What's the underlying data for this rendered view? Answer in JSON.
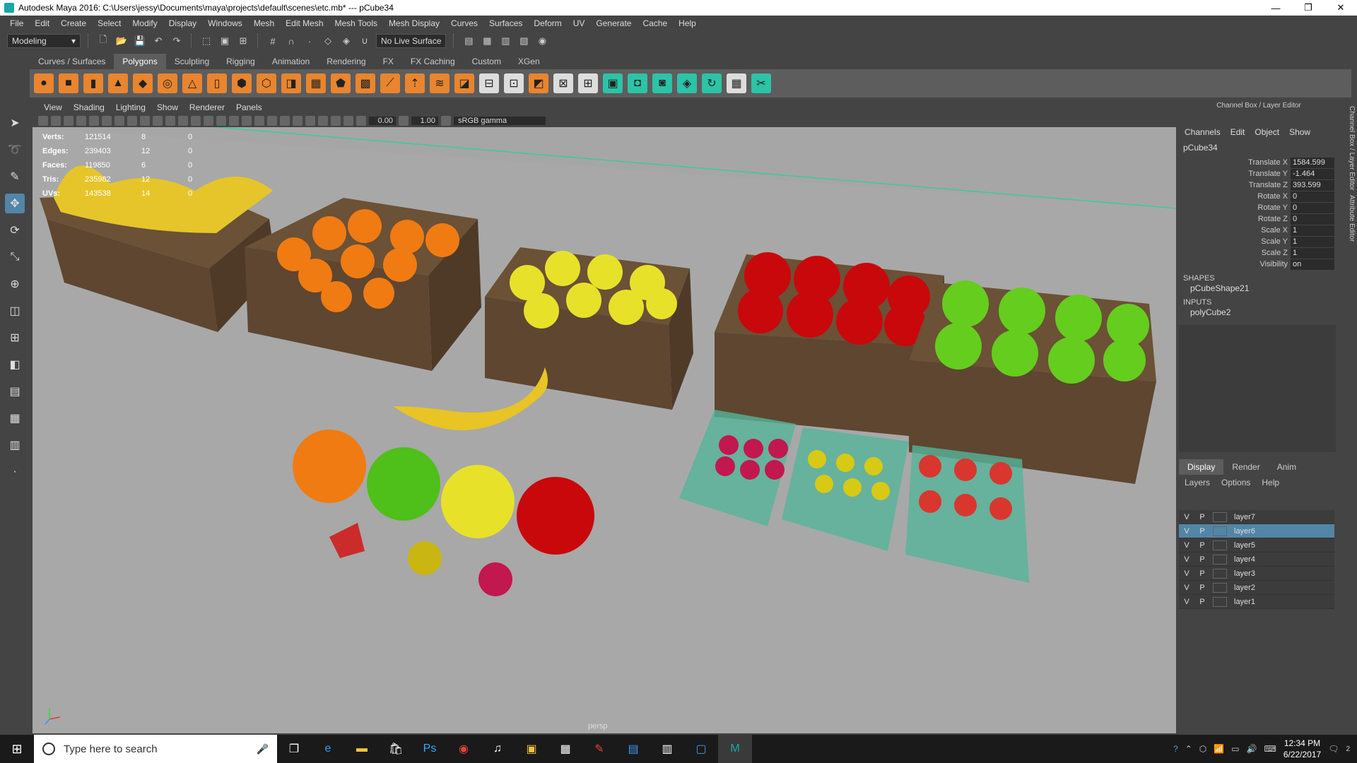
{
  "titlebar": {
    "title": "Autodesk Maya 2016: C:\\Users\\jessy\\Documents\\maya\\projects\\default\\scenes\\etc.mb*  ---  pCube34"
  },
  "menubar": [
    "File",
    "Edit",
    "Create",
    "Select",
    "Modify",
    "Display",
    "Windows",
    "Mesh",
    "Edit Mesh",
    "Mesh Tools",
    "Mesh Display",
    "Curves",
    "Surfaces",
    "Deform",
    "UV",
    "Generate",
    "Cache",
    "Help"
  ],
  "statusline": {
    "mode": "Modeling",
    "live_surface": "No Live Surface"
  },
  "shelf_tabs": [
    "Curves / Surfaces",
    "Polygons",
    "Sculpting",
    "Rigging",
    "Animation",
    "Rendering",
    "FX",
    "FX Caching",
    "Custom",
    "XGen"
  ],
  "shelf_active": "Polygons",
  "viewport": {
    "menu": [
      "View",
      "Shading",
      "Lighting",
      "Show",
      "Renderer",
      "Panels"
    ],
    "exposure": "0.00",
    "gamma_value": "1.00",
    "color_space": "sRGB gamma",
    "camera": "persp",
    "hud": [
      {
        "k": "Verts:",
        "v": "121514",
        "a": "8",
        "b": "0"
      },
      {
        "k": "Edges:",
        "v": "239403",
        "a": "12",
        "b": "0"
      },
      {
        "k": "Faces:",
        "v": "119850",
        "a": "6",
        "b": "0"
      },
      {
        "k": "Tris:",
        "v": "235982",
        "a": "12",
        "b": "0"
      },
      {
        "k": "UVs:",
        "v": "143538",
        "a": "14",
        "b": "0"
      }
    ]
  },
  "channel_box": {
    "title": "Channel Box / Layer Editor",
    "menu": [
      "Channels",
      "Edit",
      "Object",
      "Show"
    ],
    "object": "pCube34",
    "attrs": [
      {
        "n": "Translate X",
        "v": "1584.599"
      },
      {
        "n": "Translate Y",
        "v": "-1.464"
      },
      {
        "n": "Translate Z",
        "v": "393.599"
      },
      {
        "n": "Rotate X",
        "v": "0"
      },
      {
        "n": "Rotate Y",
        "v": "0"
      },
      {
        "n": "Rotate Z",
        "v": "0"
      },
      {
        "n": "Scale X",
        "v": "1"
      },
      {
        "n": "Scale Y",
        "v": "1"
      },
      {
        "n": "Scale Z",
        "v": "1"
      },
      {
        "n": "Visibility",
        "v": "on"
      }
    ],
    "shapes_label": "SHAPES",
    "shape": "pCubeShape21",
    "inputs_label": "INPUTS",
    "input": "polyCube2"
  },
  "layer_editor": {
    "tabs": [
      "Display",
      "Render",
      "Anim"
    ],
    "menu": [
      "Layers",
      "Options",
      "Help"
    ],
    "layers": [
      {
        "v": "V",
        "p": "P",
        "name": "layer7",
        "selected": false
      },
      {
        "v": "V",
        "p": "P",
        "name": "layer6",
        "selected": true
      },
      {
        "v": "V",
        "p": "P",
        "name": "layer5",
        "selected": false
      },
      {
        "v": "V",
        "p": "P",
        "name": "layer4",
        "selected": false
      },
      {
        "v": "V",
        "p": "P",
        "name": "layer3",
        "selected": false
      },
      {
        "v": "V",
        "p": "P",
        "name": "layer2",
        "selected": false
      },
      {
        "v": "V",
        "p": "P",
        "name": "layer1",
        "selected": false
      }
    ]
  },
  "side_tabs": [
    "Channel Box / Layer Editor",
    "Attribute Editor"
  ],
  "taskbar": {
    "search_placeholder": "Type here to search",
    "time": "12:34 PM",
    "date": "6/22/2017",
    "notif_count": "2"
  },
  "colors": {
    "accent": "#5285a6",
    "viewport_bg": "#a6a6a6",
    "panel": "#444444",
    "maya_teal": "#1aa5a8"
  }
}
